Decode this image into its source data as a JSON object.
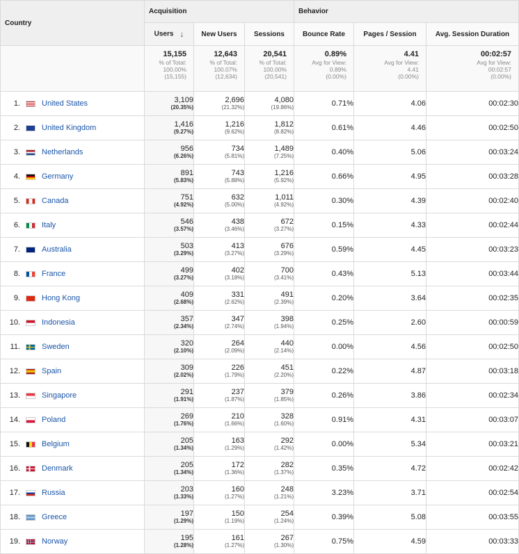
{
  "header": {
    "country": "Country",
    "acquisition": "Acquisition",
    "behavior": "Behavior",
    "columns": [
      "Users",
      "New Users",
      "Sessions",
      "Bounce Rate",
      "Pages / Session",
      "Avg. Session Duration"
    ],
    "sort_icon": "arrow-down-icon"
  },
  "totals": {
    "users": {
      "value": "15,155",
      "l1": "% of Total:",
      "l2": "100.00%",
      "l3": "(15,155)"
    },
    "new_users": {
      "value": "12,643",
      "l1": "% of Total:",
      "l2": "100.07%",
      "l3": "(12,634)"
    },
    "sessions": {
      "value": "20,541",
      "l1": "% of Total:",
      "l2": "100.00%",
      "l3": "(20,541)"
    },
    "bounce": {
      "value": "0.89%",
      "l1": "Avg for View:",
      "l2": "0.89%",
      "l3": "(0.00%)"
    },
    "pages": {
      "value": "4.41",
      "l1": "Avg for View:",
      "l2": "4.41",
      "l3": "(0.00%)"
    },
    "duration": {
      "value": "00:02:57",
      "l1": "Avg for View:",
      "l2": "00:02:57",
      "l3": "(0.00%)"
    }
  },
  "rows": [
    {
      "rank": "1.",
      "country": "United States",
      "flag": "us-flag-icon",
      "users": "3,109",
      "users_pct": "(20.35%)",
      "new": "2,696",
      "new_pct": "(21.32%)",
      "sessions": "4,080",
      "sessions_pct": "(19.86%)",
      "bounce": "0.71%",
      "pages": "4.06",
      "duration": "00:02:30"
    },
    {
      "rank": "2.",
      "country": "United Kingdom",
      "flag": "uk-flag-icon",
      "users": "1,416",
      "users_pct": "(9.27%)",
      "new": "1,216",
      "new_pct": "(9.62%)",
      "sessions": "1,812",
      "sessions_pct": "(8.82%)",
      "bounce": "0.61%",
      "pages": "4.46",
      "duration": "00:02:50"
    },
    {
      "rank": "3.",
      "country": "Netherlands",
      "flag": "nl-flag-icon",
      "users": "956",
      "users_pct": "(6.26%)",
      "new": "734",
      "new_pct": "(5.81%)",
      "sessions": "1,489",
      "sessions_pct": "(7.25%)",
      "bounce": "0.40%",
      "pages": "5.06",
      "duration": "00:03:24"
    },
    {
      "rank": "4.",
      "country": "Germany",
      "flag": "de-flag-icon",
      "users": "891",
      "users_pct": "(5.83%)",
      "new": "743",
      "new_pct": "(5.88%)",
      "sessions": "1,216",
      "sessions_pct": "(5.92%)",
      "bounce": "0.66%",
      "pages": "4.95",
      "duration": "00:03:28"
    },
    {
      "rank": "5.",
      "country": "Canada",
      "flag": "ca-flag-icon",
      "users": "751",
      "users_pct": "(4.92%)",
      "new": "632",
      "new_pct": "(5.00%)",
      "sessions": "1,011",
      "sessions_pct": "(4.92%)",
      "bounce": "0.30%",
      "pages": "4.39",
      "duration": "00:02:40"
    },
    {
      "rank": "6.",
      "country": "Italy",
      "flag": "it-flag-icon",
      "users": "546",
      "users_pct": "(3.57%)",
      "new": "438",
      "new_pct": "(3.46%)",
      "sessions": "672",
      "sessions_pct": "(3.27%)",
      "bounce": "0.15%",
      "pages": "4.33",
      "duration": "00:02:44"
    },
    {
      "rank": "7.",
      "country": "Australia",
      "flag": "au-flag-icon",
      "users": "503",
      "users_pct": "(3.29%)",
      "new": "413",
      "new_pct": "(3.27%)",
      "sessions": "676",
      "sessions_pct": "(3.29%)",
      "bounce": "0.59%",
      "pages": "4.45",
      "duration": "00:03:23"
    },
    {
      "rank": "8.",
      "country": "France",
      "flag": "fr-flag-icon",
      "users": "499",
      "users_pct": "(3.27%)",
      "new": "402",
      "new_pct": "(3.18%)",
      "sessions": "700",
      "sessions_pct": "(3.41%)",
      "bounce": "0.43%",
      "pages": "5.13",
      "duration": "00:03:44"
    },
    {
      "rank": "9.",
      "country": "Hong Kong",
      "flag": "hk-flag-icon",
      "users": "409",
      "users_pct": "(2.68%)",
      "new": "331",
      "new_pct": "(2.62%)",
      "sessions": "491",
      "sessions_pct": "(2.39%)",
      "bounce": "0.20%",
      "pages": "3.64",
      "duration": "00:02:35"
    },
    {
      "rank": "10.",
      "country": "Indonesia",
      "flag": "id-flag-icon",
      "users": "357",
      "users_pct": "(2.34%)",
      "new": "347",
      "new_pct": "(2.74%)",
      "sessions": "398",
      "sessions_pct": "(1.94%)",
      "bounce": "0.25%",
      "pages": "2.60",
      "duration": "00:00:59"
    },
    {
      "rank": "11.",
      "country": "Sweden",
      "flag": "se-flag-icon",
      "users": "320",
      "users_pct": "(2.10%)",
      "new": "264",
      "new_pct": "(2.09%)",
      "sessions": "440",
      "sessions_pct": "(2.14%)",
      "bounce": "0.00%",
      "pages": "4.56",
      "duration": "00:02:50"
    },
    {
      "rank": "12.",
      "country": "Spain",
      "flag": "es-flag-icon",
      "users": "309",
      "users_pct": "(2.02%)",
      "new": "226",
      "new_pct": "(1.79%)",
      "sessions": "451",
      "sessions_pct": "(2.20%)",
      "bounce": "0.22%",
      "pages": "4.87",
      "duration": "00:03:18"
    },
    {
      "rank": "13.",
      "country": "Singapore",
      "flag": "sg-flag-icon",
      "users": "291",
      "users_pct": "(1.91%)",
      "new": "237",
      "new_pct": "(1.87%)",
      "sessions": "379",
      "sessions_pct": "(1.85%)",
      "bounce": "0.26%",
      "pages": "3.86",
      "duration": "00:02:34"
    },
    {
      "rank": "14.",
      "country": "Poland",
      "flag": "pl-flag-icon",
      "users": "269",
      "users_pct": "(1.76%)",
      "new": "210",
      "new_pct": "(1.66%)",
      "sessions": "328",
      "sessions_pct": "(1.60%)",
      "bounce": "0.91%",
      "pages": "4.31",
      "duration": "00:03:07"
    },
    {
      "rank": "15.",
      "country": "Belgium",
      "flag": "be-flag-icon",
      "users": "205",
      "users_pct": "(1.34%)",
      "new": "163",
      "new_pct": "(1.29%)",
      "sessions": "292",
      "sessions_pct": "(1.42%)",
      "bounce": "0.00%",
      "pages": "5.34",
      "duration": "00:03:21"
    },
    {
      "rank": "16.",
      "country": "Denmark",
      "flag": "dk-flag-icon",
      "users": "205",
      "users_pct": "(1.34%)",
      "new": "172",
      "new_pct": "(1.36%)",
      "sessions": "282",
      "sessions_pct": "(1.37%)",
      "bounce": "0.35%",
      "pages": "4.72",
      "duration": "00:02:42"
    },
    {
      "rank": "17.",
      "country": "Russia",
      "flag": "ru-flag-icon",
      "users": "203",
      "users_pct": "(1.33%)",
      "new": "160",
      "new_pct": "(1.27%)",
      "sessions": "248",
      "sessions_pct": "(1.21%)",
      "bounce": "3.23%",
      "pages": "3.71",
      "duration": "00:02:54"
    },
    {
      "rank": "18.",
      "country": "Greece",
      "flag": "gr-flag-icon",
      "users": "197",
      "users_pct": "(1.29%)",
      "new": "150",
      "new_pct": "(1.19%)",
      "sessions": "254",
      "sessions_pct": "(1.24%)",
      "bounce": "0.39%",
      "pages": "5.08",
      "duration": "00:03:55"
    },
    {
      "rank": "19.",
      "country": "Norway",
      "flag": "no-flag-icon",
      "users": "195",
      "users_pct": "(1.28%)",
      "new": "161",
      "new_pct": "(1.27%)",
      "sessions": "267",
      "sessions_pct": "(1.30%)",
      "bounce": "0.75%",
      "pages": "4.59",
      "duration": "00:03:33"
    }
  ]
}
